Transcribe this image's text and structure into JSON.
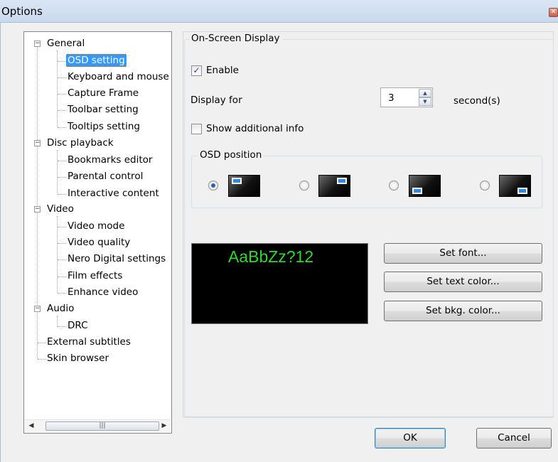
{
  "window": {
    "title": "Options",
    "close_glyph": "✕"
  },
  "tree": {
    "items": [
      {
        "label": "General"
      },
      {
        "label": "OSD setting"
      },
      {
        "label": "Keyboard and mouse"
      },
      {
        "label": "Capture Frame"
      },
      {
        "label": "Toolbar setting"
      },
      {
        "label": "Tooltips setting"
      },
      {
        "label": "Disc playback"
      },
      {
        "label": "Bookmarks editor"
      },
      {
        "label": "Parental control"
      },
      {
        "label": "Interactive content"
      },
      {
        "label": "Video"
      },
      {
        "label": "Video mode"
      },
      {
        "label": "Video quality"
      },
      {
        "label": "Nero Digital settings"
      },
      {
        "label": "Film effects"
      },
      {
        "label": "Enhance video"
      },
      {
        "label": "Audio"
      },
      {
        "label": "DRC"
      },
      {
        "label": "External subtitles"
      },
      {
        "label": "Skin browser"
      }
    ],
    "selected": "OSD setting",
    "expander_glyph": "−",
    "scroll_left_glyph": "◀",
    "scroll_right_glyph": "▶",
    "scroll_thumb_glyph": "|||"
  },
  "osd": {
    "section_title": "On-Screen Display",
    "enable_label": "Enable",
    "enable_checked": true,
    "check_glyph": "✓",
    "display_for_label": "Display for",
    "display_for_value": "3",
    "spin_up_glyph": "▲",
    "spin_down_glyph": "▼",
    "seconds_label": "second(s)",
    "additional_info_label": "Show additional info",
    "additional_info_checked": false,
    "position_title": "OSD position",
    "positions": [
      "top-left",
      "top-right",
      "bottom-left",
      "bottom-right"
    ],
    "selected_position": "top-left",
    "preview_text": "AaBbZz?12",
    "preview_color": "#2ed82e",
    "set_font_label": "Set font...",
    "set_text_color_label": "Set text color...",
    "set_bkg_color_label": "Set bkg. color..."
  },
  "footer": {
    "ok_label": "OK",
    "cancel_label": "Cancel"
  }
}
